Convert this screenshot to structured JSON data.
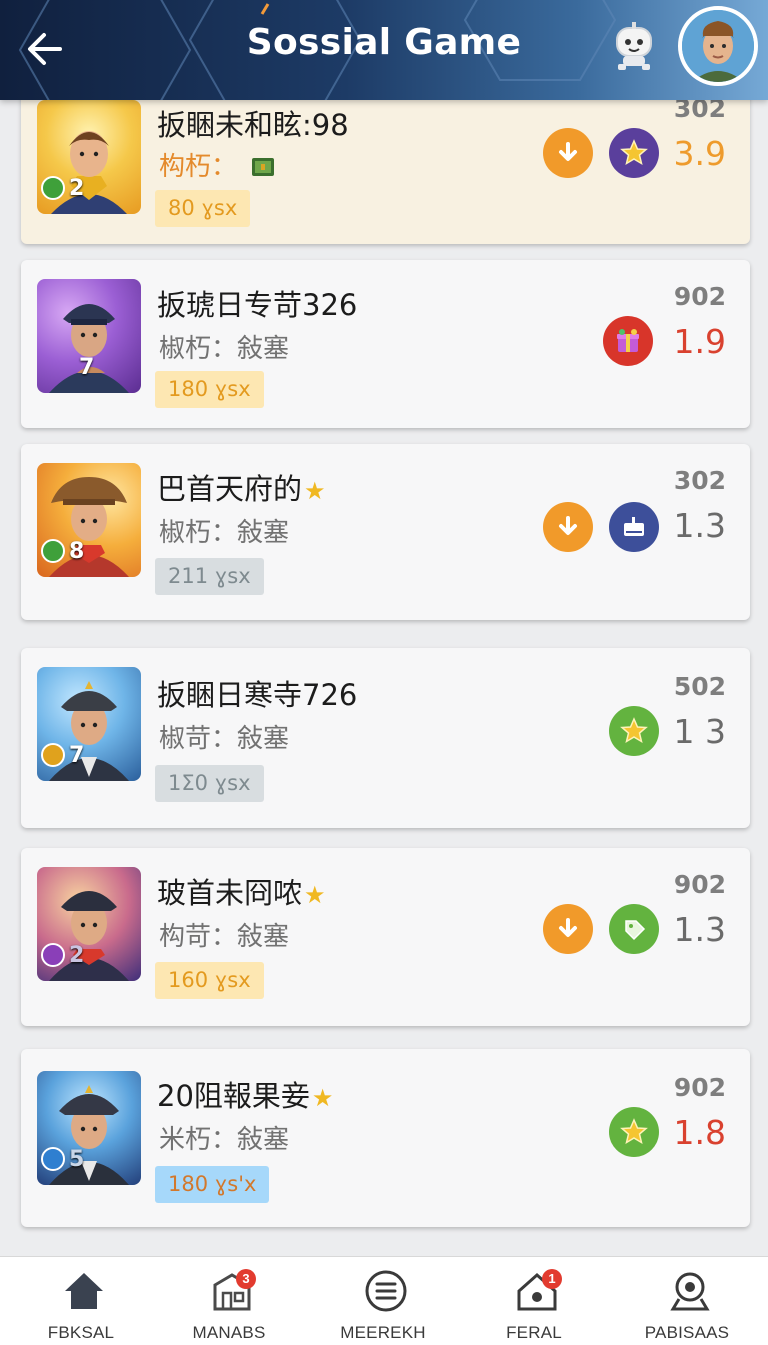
{
  "header": {
    "title": "Sossial Game",
    "back_icon": "arrow-left-icon",
    "bot_icon": "robot-icon"
  },
  "colors": {
    "accent_orange": "#f19a2a",
    "accent_purple": "#5a3f9c",
    "accent_green": "#63b33f",
    "accent_red": "#e23b2f",
    "score_red": "#d9412f",
    "score_orange": "#ee9b2c"
  },
  "cards": [
    {
      "name": "扳睏未和眩:98",
      "sub": "构朽：",
      "tag": "80 ɣsx",
      "score_top": "302",
      "score": "3.9",
      "level": "2",
      "icons": [
        "download-icon",
        "star-icon"
      ]
    },
    {
      "name": "扳琥日专苛326",
      "sub": "椒朽：敍塞",
      "tag": "180 ɣsx",
      "score_top": "902",
      "score": "1.9",
      "level": "7",
      "icons": [
        "gift-box-icon"
      ]
    },
    {
      "name": "巴首天府的",
      "sub": "椒朽：敍塞",
      "tag": "211 ɣsx",
      "score_top": "302",
      "score": "1.3",
      "level": "8",
      "icons": [
        "download-icon",
        "chest-icon"
      ]
    },
    {
      "name": "扳睏日寒寺726",
      "sub": "椒苛：敍塞",
      "tag": "1Σ0 ɣsx",
      "score_top": "502",
      "score": "1 3",
      "level": "7",
      "icons": [
        "star-icon"
      ]
    },
    {
      "name": "玻首未冏哝",
      "sub": "构苛：敍塞",
      "tag": "160 ɣsx",
      "score_top": "902",
      "score": "1.3",
      "level": "2",
      "icons": [
        "download-icon",
        "tag-icon"
      ]
    },
    {
      "name": "20阻報果妾",
      "sub": "米朽：敍塞",
      "tag": "180 ɣs'x",
      "score_top": "902",
      "score": "1.8",
      "level": "5",
      "icons": [
        "star-icon"
      ]
    }
  ],
  "nav": [
    {
      "label": "FBKSAL",
      "icon": "home-icon",
      "badge": ""
    },
    {
      "label": "MANABS",
      "icon": "store-icon",
      "badge": "3"
    },
    {
      "label": "MEEREKH",
      "icon": "menu-icon",
      "badge": ""
    },
    {
      "label": "FERAL",
      "icon": "house-icon",
      "badge": "1"
    },
    {
      "label": "PABISAAS",
      "icon": "search-icon",
      "badge": ""
    }
  ]
}
